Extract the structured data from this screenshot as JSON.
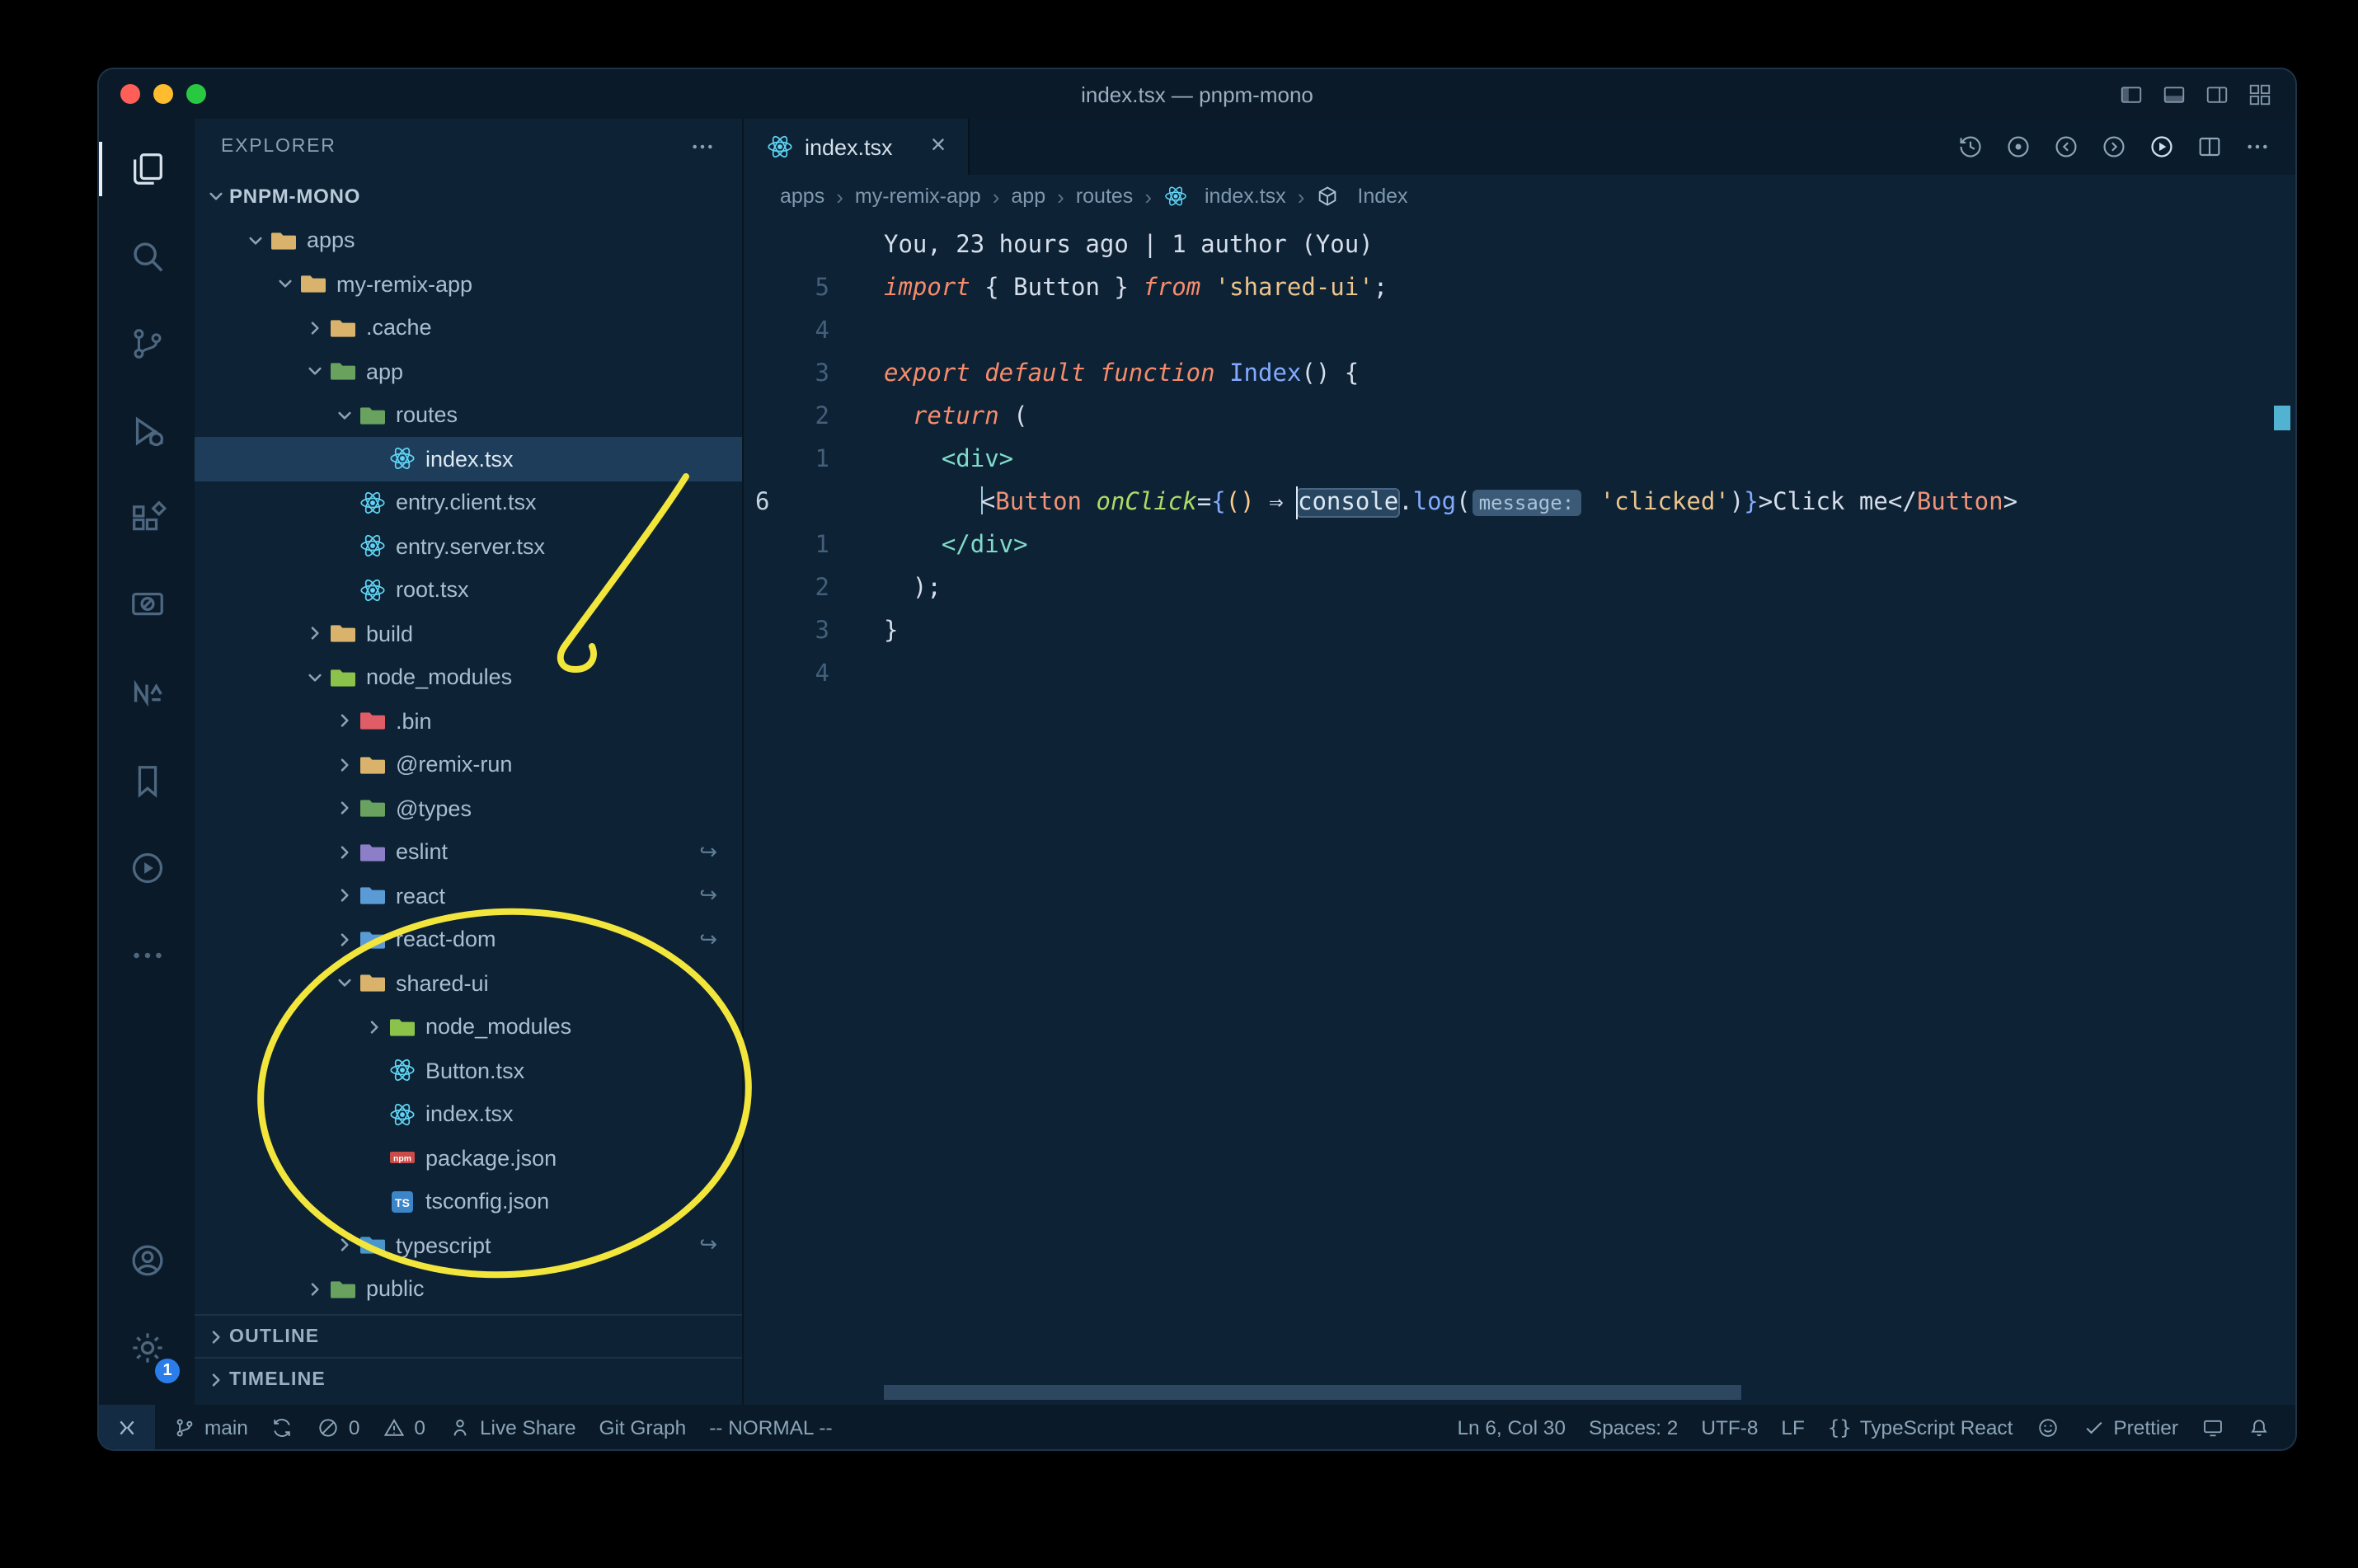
{
  "window": {
    "title": "index.tsx — pnpm-mono"
  },
  "colors": {
    "annotation_yellow": "#f2e63c",
    "badge_blue": "#2b7de9",
    "react_cyan": "#5fd4f4",
    "selection_row": "#1d3d5a"
  },
  "titlebar_icons": [
    "panel-left",
    "panel-bottom",
    "panel-right",
    "layout"
  ],
  "activity_bar": {
    "items": [
      {
        "name": "explorer",
        "active": true
      },
      {
        "name": "search"
      },
      {
        "name": "source-control"
      },
      {
        "name": "run-debug"
      },
      {
        "name": "extensions"
      },
      {
        "name": "remote-explorer"
      },
      {
        "name": "nx-console"
      },
      {
        "name": "bookmarks"
      },
      {
        "name": "code-runner"
      },
      {
        "name": "more-views"
      }
    ],
    "bottom": [
      {
        "name": "account"
      },
      {
        "name": "settings",
        "badge": "1"
      }
    ]
  },
  "explorer": {
    "title": "EXPLORER",
    "tree": [
      {
        "label": "PNPM-MONO",
        "indent": 0,
        "type": "root",
        "expanded": true
      },
      {
        "label": "apps",
        "indent": 1,
        "type": "folder",
        "icon": "folder-orange",
        "expanded": true
      },
      {
        "label": "my-remix-app",
        "indent": 2,
        "type": "folder",
        "icon": "folder-orange",
        "expanded": true
      },
      {
        "label": ".cache",
        "indent": 3,
        "type": "folder",
        "icon": "folder-orange",
        "expanded": false
      },
      {
        "label": "app",
        "indent": 3,
        "type": "folder",
        "icon": "folder-green",
        "expanded": true
      },
      {
        "label": "routes",
        "indent": 4,
        "type": "folder",
        "icon": "folder-green",
        "expanded": true
      },
      {
        "label": "index.tsx",
        "indent": 5,
        "type": "file",
        "icon": "react",
        "selected": true
      },
      {
        "label": "entry.client.tsx",
        "indent": 4,
        "type": "file",
        "icon": "react"
      },
      {
        "label": "entry.server.tsx",
        "indent": 4,
        "type": "file",
        "icon": "react"
      },
      {
        "label": "root.tsx",
        "indent": 4,
        "type": "file",
        "icon": "react"
      },
      {
        "label": "build",
        "indent": 3,
        "type": "folder",
        "icon": "folder-orange",
        "expanded": false
      },
      {
        "label": "node_modules",
        "indent": 3,
        "type": "folder",
        "icon": "folder-node",
        "expanded": true
      },
      {
        "label": ".bin",
        "indent": 4,
        "type": "folder",
        "icon": "folder-red",
        "expanded": false
      },
      {
        "label": "@remix-run",
        "indent": 4,
        "type": "folder",
        "icon": "folder-orange",
        "expanded": false
      },
      {
        "label": "@types",
        "indent": 4,
        "type": "folder",
        "icon": "folder-green",
        "expanded": false
      },
      {
        "label": "eslint",
        "indent": 4,
        "type": "folder",
        "icon": "folder-purple",
        "expanded": false,
        "symlink": true
      },
      {
        "label": "react",
        "indent": 4,
        "type": "folder",
        "icon": "folder-blue",
        "expanded": false,
        "symlink": true
      },
      {
        "label": "react-dom",
        "indent": 4,
        "type": "folder",
        "icon": "folder-blue",
        "expanded": false,
        "symlink": true
      },
      {
        "label": "shared-ui",
        "indent": 4,
        "type": "folder",
        "icon": "folder-orange",
        "expanded": true
      },
      {
        "label": "node_modules",
        "indent": 5,
        "type": "folder",
        "icon": "folder-node",
        "expanded": false
      },
      {
        "label": "Button.tsx",
        "indent": 5,
        "type": "file",
        "icon": "react"
      },
      {
        "label": "index.tsx",
        "indent": 5,
        "type": "file",
        "icon": "react"
      },
      {
        "label": "package.json",
        "indent": 5,
        "type": "file",
        "icon": "npm"
      },
      {
        "label": "tsconfig.json",
        "indent": 5,
        "type": "file",
        "icon": "ts"
      },
      {
        "label": "typescript",
        "indent": 4,
        "type": "folder",
        "icon": "folder-ts",
        "expanded": false,
        "symlink": true
      },
      {
        "label": "public",
        "indent": 3,
        "type": "folder",
        "icon": "folder-green",
        "expanded": false
      }
    ],
    "sections": [
      {
        "label": "OUTLINE"
      },
      {
        "label": "TIMELINE"
      }
    ]
  },
  "tab": {
    "label": "index.tsx",
    "icon": "react",
    "close": "×"
  },
  "editor_actions": [
    "history",
    "open-changes",
    "prev-change",
    "next-change",
    "run",
    "split-editor",
    "more-actions"
  ],
  "breadcrumbs": [
    {
      "label": "apps"
    },
    {
      "label": "my-remix-app"
    },
    {
      "label": "app"
    },
    {
      "label": "routes"
    },
    {
      "label": "index.tsx",
      "icon": "react"
    },
    {
      "label": "Index",
      "icon": "symbol"
    }
  ],
  "editor": {
    "blame": "You, 23 hours ago | 1 author (You)",
    "lines": [
      {
        "num": "5",
        "tokens": [
          [
            "kw",
            "import"
          ],
          [
            "pln",
            " { Button } "
          ],
          [
            "kw",
            "from"
          ],
          [
            "pln",
            " "
          ],
          [
            "str",
            "'shared-ui'"
          ],
          [
            "pln",
            ";"
          ]
        ]
      },
      {
        "num": "4",
        "tokens": []
      },
      {
        "num": "3",
        "tokens": [
          [
            "kw",
            "export default function"
          ],
          [
            "pln",
            " "
          ],
          [
            "fn",
            "Index"
          ],
          [
            "pln",
            "() {"
          ]
        ]
      },
      {
        "num": "2",
        "tokens": [
          [
            "pln",
            "  "
          ],
          [
            "kw",
            "return"
          ],
          [
            "pln",
            " ("
          ]
        ]
      },
      {
        "num": "1",
        "tokens": [
          [
            "pln",
            "    "
          ],
          [
            "tag",
            "<div>"
          ]
        ]
      },
      {
        "num": "6",
        "current": true,
        "tokens": [
          [
            "pln",
            "      "
          ],
          [
            "guide",
            ""
          ],
          [
            "pln",
            "<"
          ],
          [
            "comp",
            "Button"
          ],
          [
            "pln",
            " "
          ],
          [
            "attr",
            "onClick"
          ],
          [
            "pln",
            "="
          ],
          [
            "brace",
            "{"
          ],
          [
            "paren",
            "()"
          ],
          [
            "pln",
            " "
          ],
          [
            "arrow",
            "⇒"
          ],
          [
            "pln",
            " "
          ],
          [
            "hl",
            "console"
          ],
          [
            "pln",
            "."
          ],
          [
            "fn",
            "log"
          ],
          [
            "pln",
            "("
          ],
          [
            "inlay",
            "message:"
          ],
          [
            "pln",
            " "
          ],
          [
            "str",
            "'clicked'"
          ],
          [
            "pln",
            ")"
          ],
          [
            "brace",
            "}"
          ],
          [
            "pln",
            ">Click me"
          ],
          [
            "pln",
            "</"
          ],
          [
            "comp",
            "Button"
          ],
          [
            "pln",
            ">"
          ]
        ]
      },
      {
        "num": "1",
        "tokens": [
          [
            "pln",
            "    "
          ],
          [
            "tag",
            "</div>"
          ]
        ]
      },
      {
        "num": "2",
        "tokens": [
          [
            "pln",
            "  );"
          ]
        ]
      },
      {
        "num": "3",
        "tokens": [
          [
            "pln",
            "}"
          ]
        ]
      },
      {
        "num": "4",
        "tokens": []
      }
    ]
  },
  "statusbar": {
    "left": [
      {
        "name": "remote-indicator",
        "icon": "remote",
        "label": "",
        "style": "remote"
      },
      {
        "name": "git-branch",
        "icon": "branch",
        "label": "main"
      },
      {
        "name": "sync-changes",
        "icon": "sync",
        "label": ""
      },
      {
        "name": "problems-errors",
        "icon": "error",
        "label": "0"
      },
      {
        "name": "problems-warnings",
        "icon": "warning",
        "label": "0"
      },
      {
        "name": "live-share",
        "icon": "liveshare",
        "label": "Live Share"
      },
      {
        "name": "git-graph",
        "label": "Git Graph"
      },
      {
        "name": "vim-mode",
        "label": "-- NORMAL --"
      }
    ],
    "right": [
      {
        "name": "cursor-position",
        "label": "Ln 6, Col 30"
      },
      {
        "name": "indentation",
        "label": "Spaces: 2"
      },
      {
        "name": "encoding",
        "label": "UTF-8"
      },
      {
        "name": "eol",
        "label": "LF"
      },
      {
        "name": "language-mode",
        "icon": "braces",
        "label": "TypeScript React"
      },
      {
        "name": "feedback",
        "icon": "smiley",
        "label": ""
      },
      {
        "name": "formatter-prettier",
        "icon": "check",
        "label": "Prettier"
      },
      {
        "name": "screencast",
        "icon": "screen",
        "label": ""
      },
      {
        "name": "notifications",
        "icon": "bell",
        "label": ""
      }
    ]
  }
}
